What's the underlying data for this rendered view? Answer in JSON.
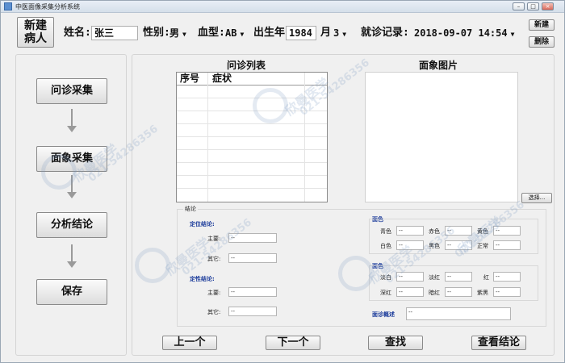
{
  "window": {
    "title": "中医面像采集分析系统"
  },
  "header": {
    "new_patient_label": "新建\n病人",
    "name_label": "姓名:",
    "name_value": "张三",
    "gender_label": "性别:",
    "gender_value": "男",
    "blood_label": "血型:",
    "blood_value": "AB",
    "birth_label": "出生年",
    "birth_year": "1984",
    "month_label": "月",
    "month_value": "3",
    "visit_label": "就诊记录:",
    "visit_value": "2018-09-07 14:54",
    "new_button": "新建",
    "delete_button": "删除"
  },
  "steps": {
    "inquiry": "问诊采集",
    "face": "面象采集",
    "analysis": "分析结论",
    "save": "保存"
  },
  "main": {
    "inquiry_list_title": "问诊列表",
    "col_no": "序号",
    "col_symptom": "症状",
    "face_image_title": "面象图片",
    "select_button": "选择...",
    "conclusion_title": "结论",
    "location_title": "定位结论:",
    "main_label": "主要:",
    "other_label": "其它:",
    "nature_title": "定性结论:",
    "main_label2": "主要:",
    "other_label2": "其它:",
    "empty_value": "--",
    "face_color_title": "面色",
    "qing": "青色",
    "chi": "赤色",
    "huang": "黄色",
    "bai": "白色",
    "hei": "黑色",
    "zhengchang": "正常",
    "color_title": "面色",
    "danbai": "淡白",
    "danhong": "淡红",
    "hong": "红",
    "shenhong": "深红",
    "anhong": "暗红",
    "zihei": "紫黑",
    "summary_label": "面诊概述",
    "v1": "--",
    "v2": "--",
    "v3": "--",
    "v4": "--",
    "v5": "--",
    "v6": "--",
    "v7": "--",
    "v8": "--",
    "v9": "--",
    "v10": "--",
    "v11": "--",
    "v12": "--",
    "v13": "--",
    "v14": "--",
    "v15": "--",
    "v16": "--",
    "v17": "--"
  },
  "footer": {
    "prev": "上一个",
    "next": "下一个",
    "search": "查找",
    "view_result": "查看结论"
  },
  "watermark": {
    "text": "欣曼医学",
    "phone": "021-54286356"
  }
}
